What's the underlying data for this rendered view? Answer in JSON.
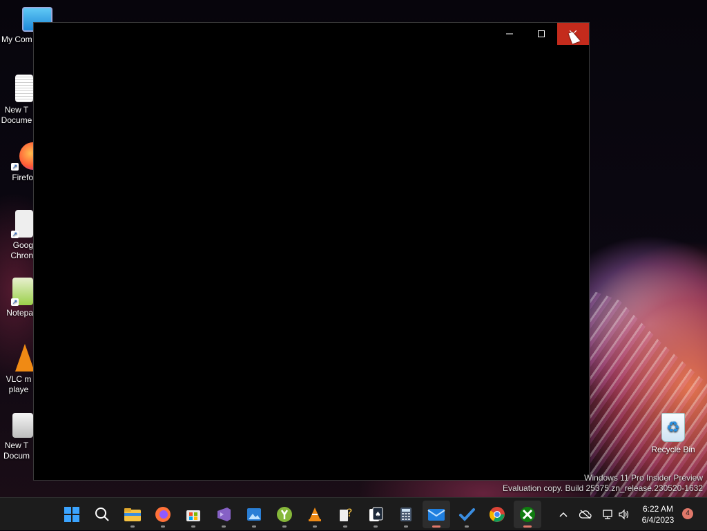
{
  "desktop": {
    "icons": [
      {
        "label": "My Com",
        "icon": "computer-icon"
      },
      {
        "label": "New T Docume",
        "icon": "text-document-icon"
      },
      {
        "label": "Firefo",
        "icon": "firefox-icon"
      },
      {
        "label": "Goog Chron",
        "icon": "chrome-icon"
      },
      {
        "label": "Notepa",
        "icon": "notepad-plus-plus-icon"
      },
      {
        "label": "VLC m playe",
        "icon": "vlc-icon"
      },
      {
        "label": "New T Docum",
        "icon": "text-document-icon"
      }
    ],
    "recycle_bin": {
      "label": "Recycle Bin",
      "icon": "recycle-bin-icon"
    }
  },
  "window": {
    "minimize_icon": "minimize-icon",
    "maximize_icon": "maximize-icon",
    "close_icon": "close-icon"
  },
  "watermark": {
    "line1": "Windows 11 Pro Insider Preview",
    "line2": "Evaluation copy. Build 25375.zn_release.230520-1632"
  },
  "taskbar": {
    "apps": [
      {
        "name": "start",
        "icon": "windows-start-icon",
        "open": false
      },
      {
        "name": "search",
        "icon": "search-icon",
        "open": false
      },
      {
        "name": "file-explorer",
        "icon": "folder-icon",
        "open": true
      },
      {
        "name": "firefox",
        "icon": "firefox-icon",
        "open": true
      },
      {
        "name": "microsoft-store",
        "icon": "store-icon",
        "open": true
      },
      {
        "name": "visual-studio",
        "icon": "visual-studio-icon",
        "open": true
      },
      {
        "name": "photos",
        "icon": "photos-icon",
        "open": true
      },
      {
        "name": "app-y",
        "icon": "green-y-icon",
        "open": true
      },
      {
        "name": "vlc",
        "icon": "vlc-icon",
        "open": true
      },
      {
        "name": "tips",
        "icon": "tips-icon",
        "open": true
      },
      {
        "name": "solitaire",
        "icon": "cards-icon",
        "open": true
      },
      {
        "name": "calculator",
        "icon": "calculator-icon",
        "open": true
      },
      {
        "name": "mail",
        "icon": "mail-icon",
        "open": true
      },
      {
        "name": "todo",
        "icon": "checkmark-icon",
        "open": true
      },
      {
        "name": "chrome",
        "icon": "chrome-icon",
        "open": false
      },
      {
        "name": "xbox",
        "icon": "xbox-icon",
        "open": true,
        "active": true
      }
    ],
    "tray": {
      "chevron_icon": "chevron-up-icon",
      "cloud_icon": "cloud-off-icon",
      "network_icon": "network-icon",
      "volume_icon": "volume-icon"
    },
    "clock": {
      "time": "6:22 AM",
      "date": "6/4/2023"
    },
    "notification_count": "4"
  },
  "colors": {
    "close_hover": "#c42b1c",
    "taskbar_bg": "#1c1c1c",
    "accent_pip": "#e0786a"
  }
}
